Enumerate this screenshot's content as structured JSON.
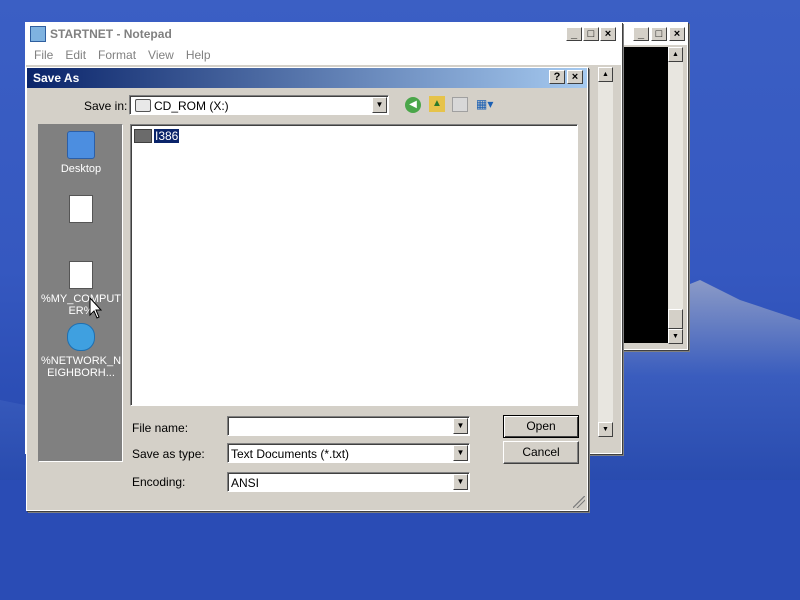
{
  "notepad": {
    "title": "STARTNET - Notepad",
    "menu": [
      "File",
      "Edit",
      "Format",
      "View",
      "Help"
    ]
  },
  "cmd_window": {},
  "dialog": {
    "title": "Save As",
    "help_btn": "?",
    "close_btn": "×",
    "save_in_label": "Save in:",
    "save_in_value": "CD_ROM (X:)",
    "places": [
      {
        "label": "Desktop",
        "icon": "desktop-icon"
      },
      {
        "label": "",
        "icon": "document-icon"
      },
      {
        "label": "%MY_COMPUTER%",
        "icon": "document-icon"
      },
      {
        "label": "%NETWORK_NEIGHBORH...",
        "icon": "network-icon"
      }
    ],
    "files": [
      {
        "name": "I386",
        "icon": "folder-icon"
      }
    ],
    "file_name_label": "File name:",
    "file_name_value": "",
    "save_as_type_label": "Save as type:",
    "save_as_type_value": "Text Documents (*.txt)",
    "encoding_label": "Encoding:",
    "encoding_value": "ANSI",
    "open_button": "Open",
    "cancel_button": "Cancel"
  },
  "colors": {
    "desktop": "#3558c0",
    "titlebar_active": "#0a246a",
    "face": "#d4d0c8"
  }
}
